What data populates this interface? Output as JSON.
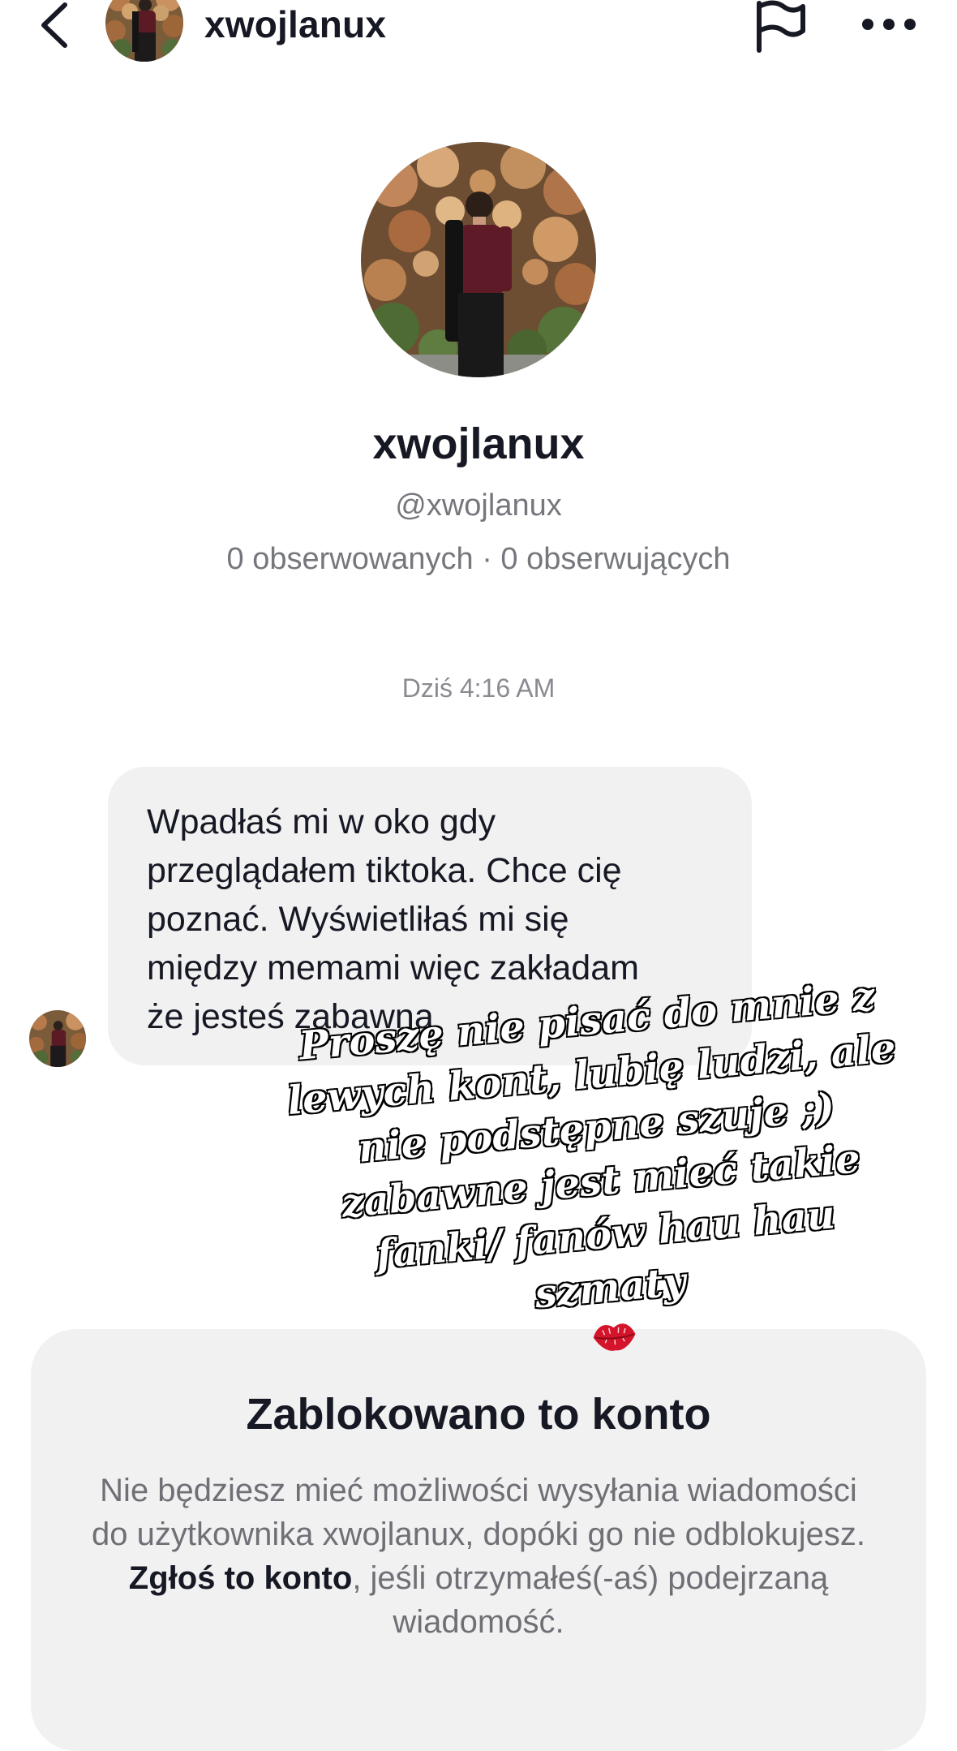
{
  "header": {
    "username": "xwojlanux",
    "back_icon": "chevron-left-icon",
    "flag_icon": "flag-icon",
    "more_icon": "ellipsis-horizontal-icon"
  },
  "profile": {
    "name": "xwojlanux",
    "handle": "@xwojlanux",
    "stats": "0 obserwowanych · 0 obserwujących"
  },
  "chat": {
    "timestamp": "Dziś 4:16 AM",
    "message": "Wpadłaś mi w oko gdy\nprzeglądałem tiktoka. Chce cię\npoznać. Wyświetliłaś mi się\nmiędzy memami więc zakładam\nże jesteś zabawna"
  },
  "overlay": {
    "text": "Proszę nie pisać do mnie z\nlewych kont, lubię ludzi, ale\nnie podstępne szuje ;)\nzabawne jest mieć takie\nfanki/ fanów hau hau szmaty",
    "emoji_icon": "kiss-lips-icon"
  },
  "blocked": {
    "title": "Zablokowano to konto",
    "body_prefix": "Nie będziesz mieć możliwości wysyłania wiadomości do użytkownika xwojlanux, dopóki go nie odblokujesz. ",
    "report_link": "Zgłoś to konto",
    "body_suffix": ", jeśli otrzymałeś(-aś) podejrzaną wiadomość."
  },
  "colors": {
    "text_primary": "#161823",
    "text_secondary": "#75777d",
    "bubble_bg": "#f1f1f2",
    "lips_red": "#d4142a"
  }
}
